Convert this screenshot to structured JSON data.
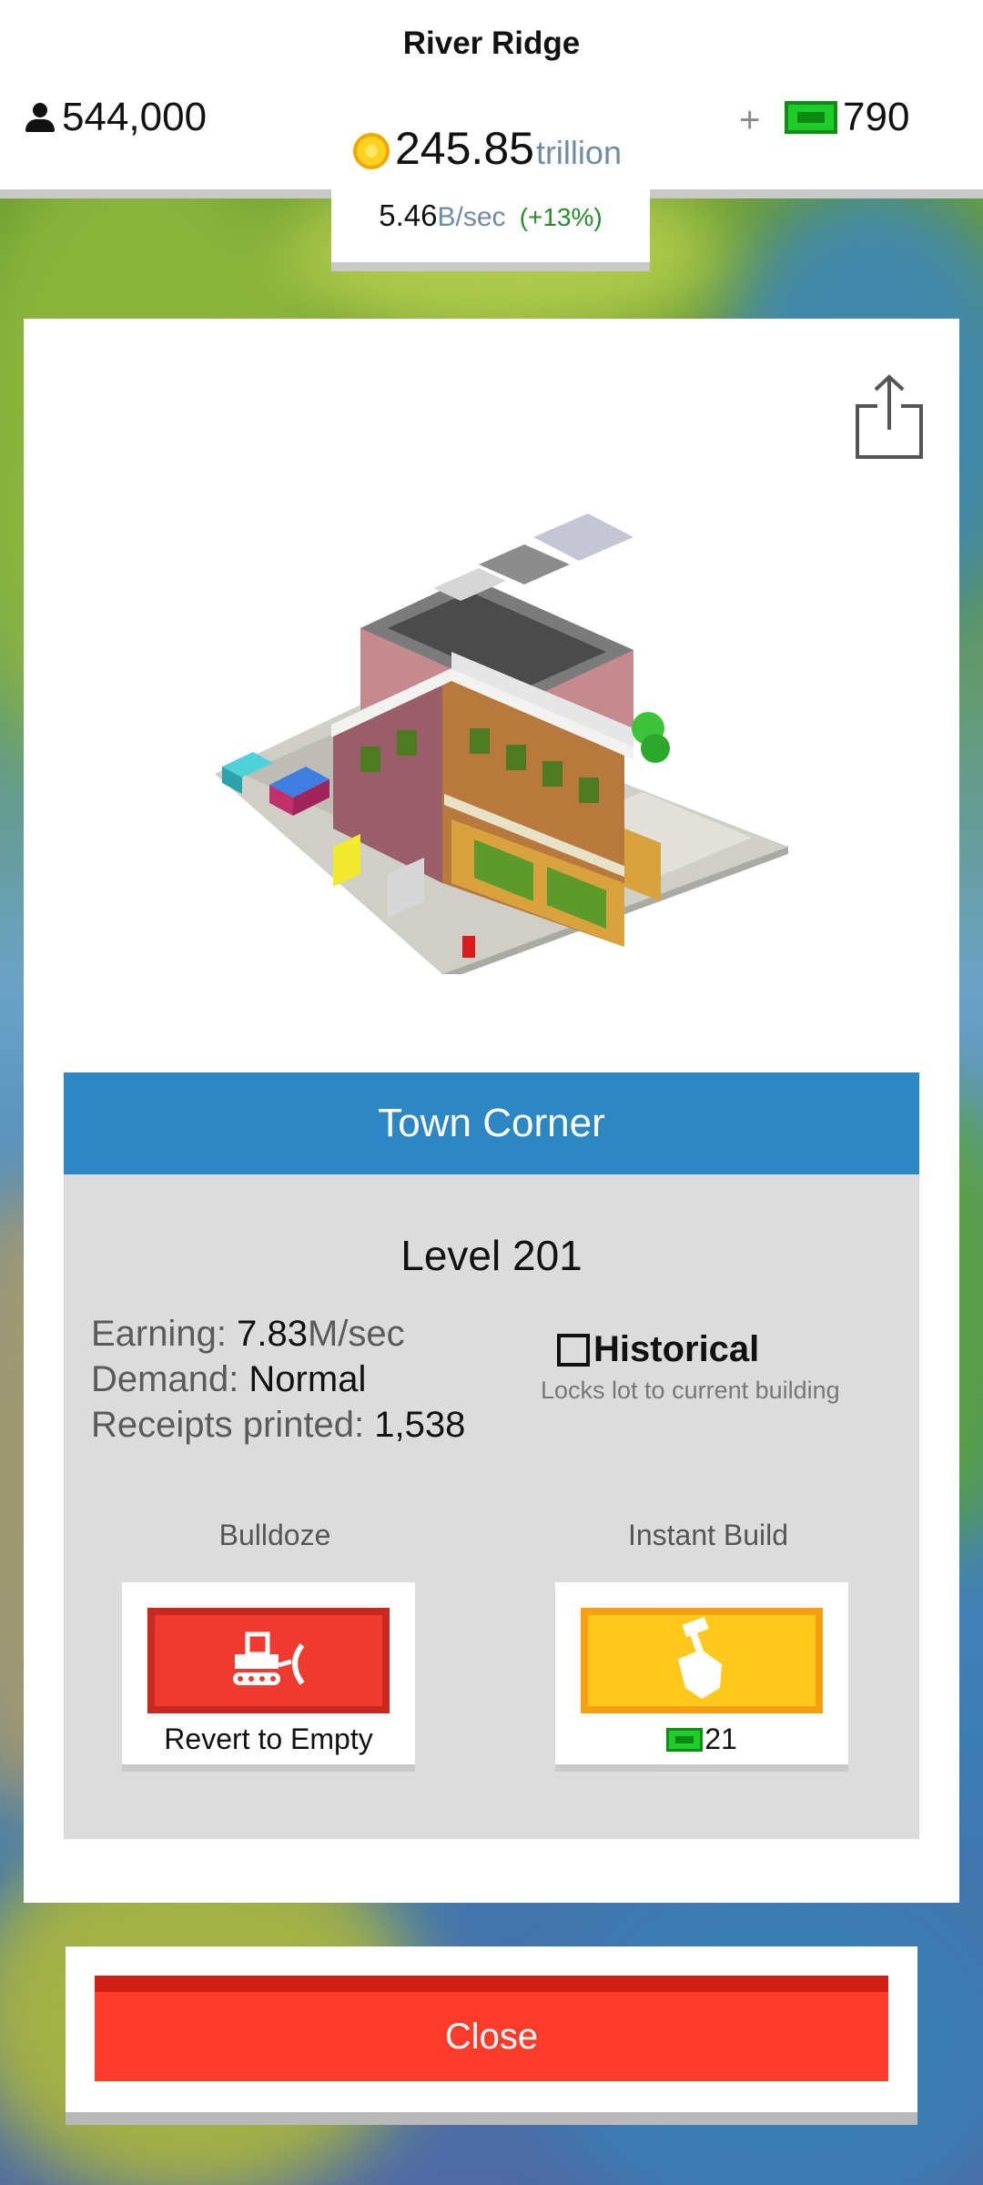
{
  "header": {
    "city_name": "River Ridge",
    "population": "544,000",
    "cash": "790",
    "plus_label": "+",
    "money_value": "245.85",
    "money_unit": "trillion",
    "rate_value": "5.46",
    "rate_unit": "B/sec",
    "rate_change": "(+13%)"
  },
  "card": {
    "building_name": "Town Corner",
    "level": "Level 201",
    "stats": {
      "earning_label": "Earning: ",
      "earning_value": "7.83",
      "earning_unit": "M/sec",
      "demand_label": "Demand: ",
      "demand_value": "Normal",
      "receipts_label": "Receipts printed: ",
      "receipts_value": "1,538"
    },
    "historical": {
      "label": "Historical",
      "subtitle": "Locks lot to current building",
      "checked": false
    },
    "bulldoze": {
      "caption": "Bulldoze",
      "button_label": "Revert to Empty"
    },
    "instant_build": {
      "caption": "Instant Build",
      "cost": "21"
    }
  },
  "footer": {
    "close_label": "Close"
  },
  "colors": {
    "title_bar": "#2c87c2",
    "bulldoze_button": "#ef3a2f",
    "instant_build_button": "#ffc81a",
    "close_button": "#ff3b2a",
    "cash_green": "#1fcc2b",
    "coin_gold": "#ffd21f"
  },
  "icons": {
    "population": "person-icon",
    "cash": "cash-bill-icon",
    "money": "coin-icon",
    "share": "share-icon",
    "bulldoze": "bulldozer-icon",
    "instant_build": "hammer-hand-icon"
  }
}
